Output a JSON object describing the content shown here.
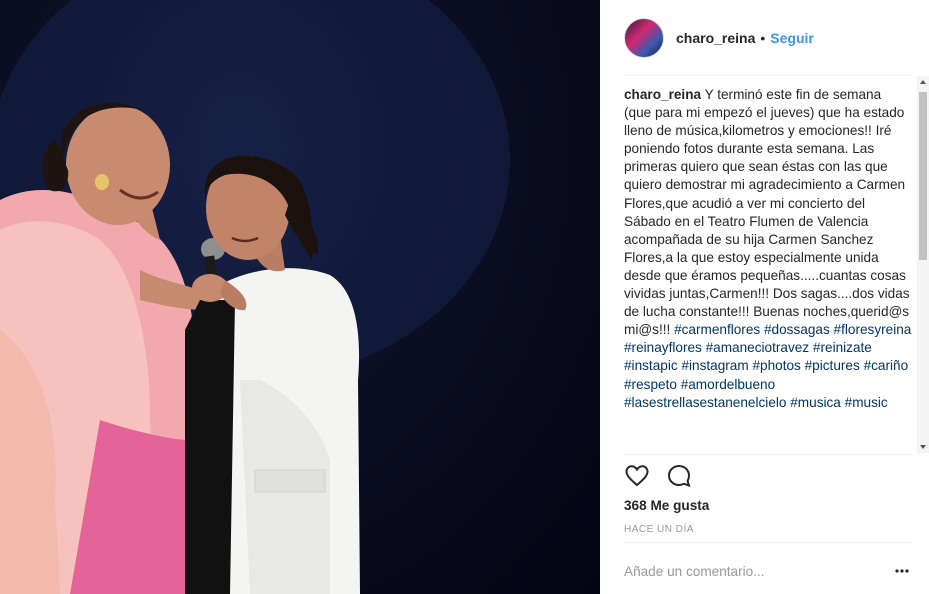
{
  "photo": {
    "alt_subject": "two-singers-on-stage"
  },
  "header": {
    "username": "charo_reina",
    "separator": "•",
    "follow_label": "Seguir"
  },
  "caption": {
    "username": "charo_reina",
    "text": "Y terminó este fin de semana (que para mi empezó el jueves) que ha estado lleno de música,kilometros y emociones!! Iré poniendo fotos durante esta semana. Las primeras quiero que sean éstas con las que quiero demostrar mi agradecimiento a Carmen Flores,que acudió a ver mi concierto del Sábado en el Teatro Flumen de Valencia acompañada de su hija Carmen Sanchez Flores,a la que estoy especialmente unida desde que éramos pequeñas.....cuantas cosas vividas juntas,Carmen!!! Dos sagas....dos vidas de lucha constante!!! Buenas noches,querid@s mi@s!!! ",
    "hashtags": [
      "#carmenflores",
      "#dossagas",
      "#floresyreina",
      "#reinayflores",
      "#amaneciotravez",
      "#reinizate",
      "#instapic",
      "#instagram",
      "#photos",
      "#pictures",
      "#cariño",
      "#respeto",
      "#amordelbueno",
      "#lasestrellasestanenelcielo",
      "#musica",
      "#music"
    ]
  },
  "actions": {
    "like_icon": "heart-icon",
    "comment_icon": "comment-icon"
  },
  "likes": "368 Me gusta",
  "timestamp": "HACE UN DÍA",
  "comment": {
    "placeholder": "Añade un comentario...",
    "more_icon": "more-options-icon"
  },
  "colors": {
    "link": "#3897f0",
    "hashtag": "#003569",
    "text": "#262626",
    "muted": "#999999"
  }
}
